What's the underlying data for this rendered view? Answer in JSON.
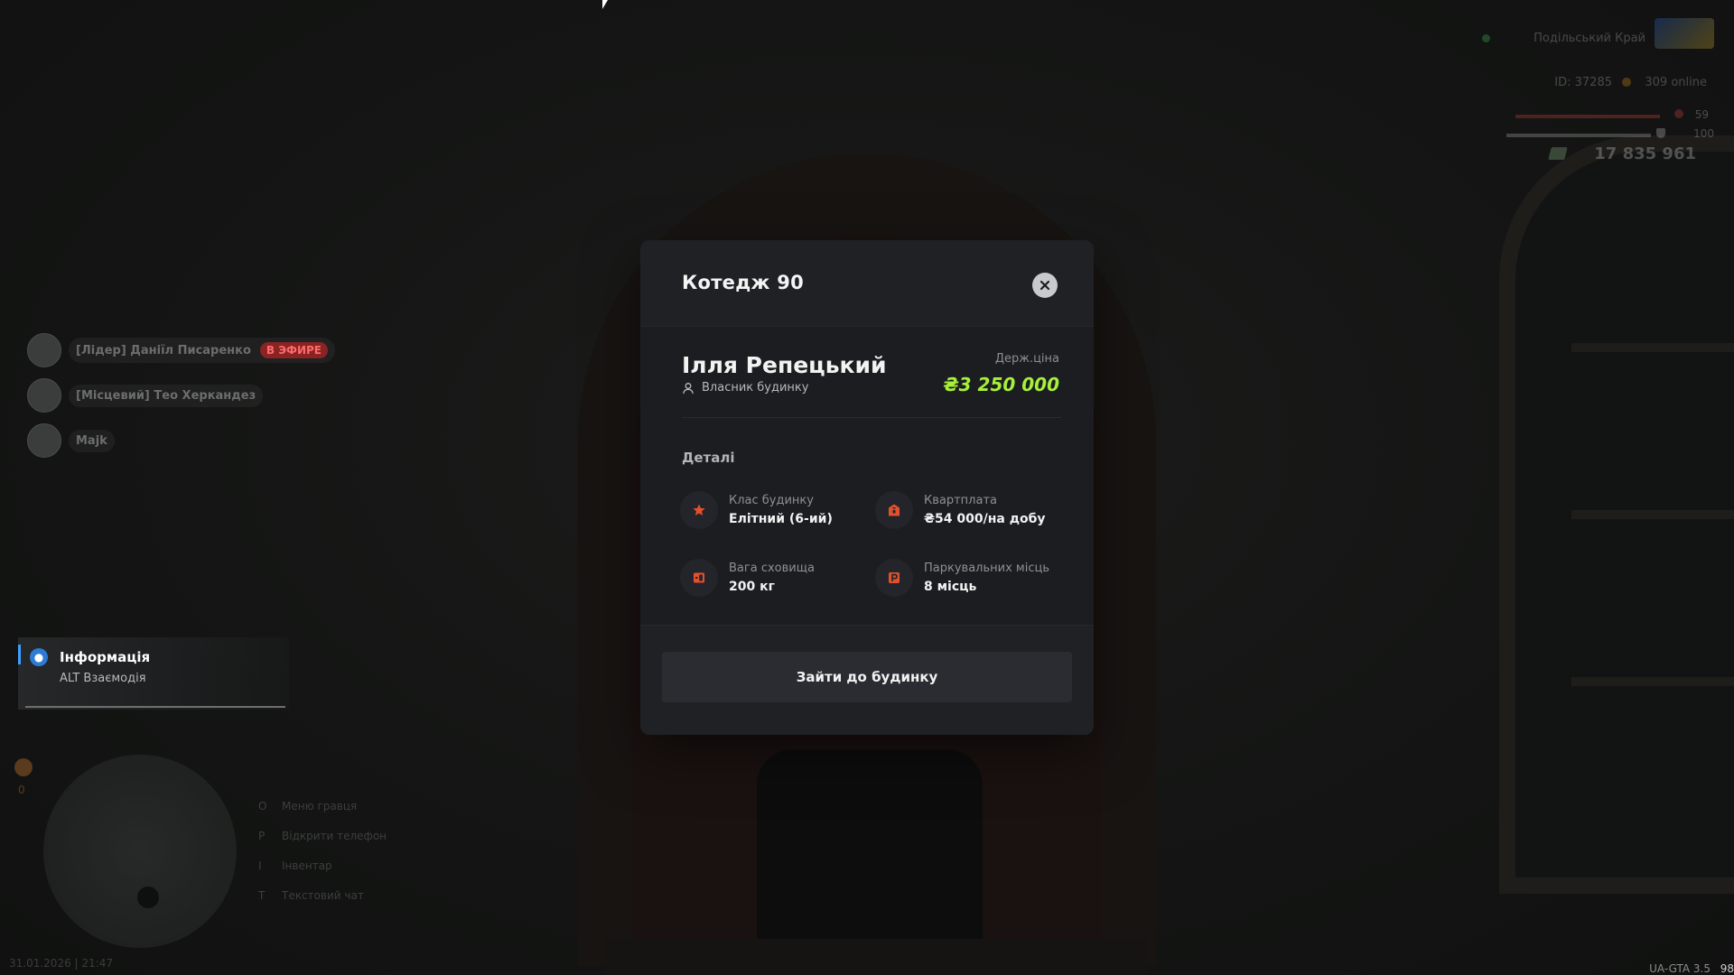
{
  "hud": {
    "server_name": "Подільський Край",
    "player_id": "ID: 37285",
    "online": "309 online",
    "health": "59",
    "armor": "100",
    "money": "17 835 961"
  },
  "voice_list": [
    {
      "name": "[Лідер] Даніїл Писаренко",
      "badge": "В ЭФИРЕ"
    },
    {
      "name": "[Місцевий] Тео Херкандез",
      "badge": ""
    },
    {
      "name": "Majk",
      "badge": ""
    }
  ],
  "info_panel": {
    "title": "Інформація",
    "subtitle": "ALT Взаємодія"
  },
  "hints": [
    {
      "key": "O",
      "label": "Меню гравця"
    },
    {
      "key": "P",
      "label": "Відкрити телефон"
    },
    {
      "key": "I",
      "label": "Інвентар"
    },
    {
      "key": "T",
      "label": "Текстовий чат"
    }
  ],
  "minimap": {
    "counter": "0"
  },
  "footer": {
    "datetime": "31.01.2026 | 21:47",
    "version": "UA-GTA 3.5",
    "fps": "98"
  },
  "modal": {
    "title": "Котедж 90",
    "owner_name": "Ілля Репецький",
    "owner_role": "Власник будинку",
    "price_label": "Держ.ціна",
    "price_value": "₴3 250 000",
    "details_title": "Деталі",
    "details": [
      {
        "icon": "star-icon",
        "label": "Клас будинку",
        "value": "Елітний (6-ий)"
      },
      {
        "icon": "rent-icon",
        "label": "Квартплата",
        "value": "₴54 000/на добу"
      },
      {
        "icon": "storage-icon",
        "label": "Вага сховища",
        "value": "200 кг"
      },
      {
        "icon": "parking-icon",
        "label": "Паркувальних місць",
        "value": "8 місць"
      }
    ],
    "enter_button": "Зайти до будинку"
  },
  "colors": {
    "accent_icon": "#e5502c",
    "price": "#a7f03a",
    "live_badge": "#8a2323",
    "info_accent": "#3aa1ff"
  }
}
